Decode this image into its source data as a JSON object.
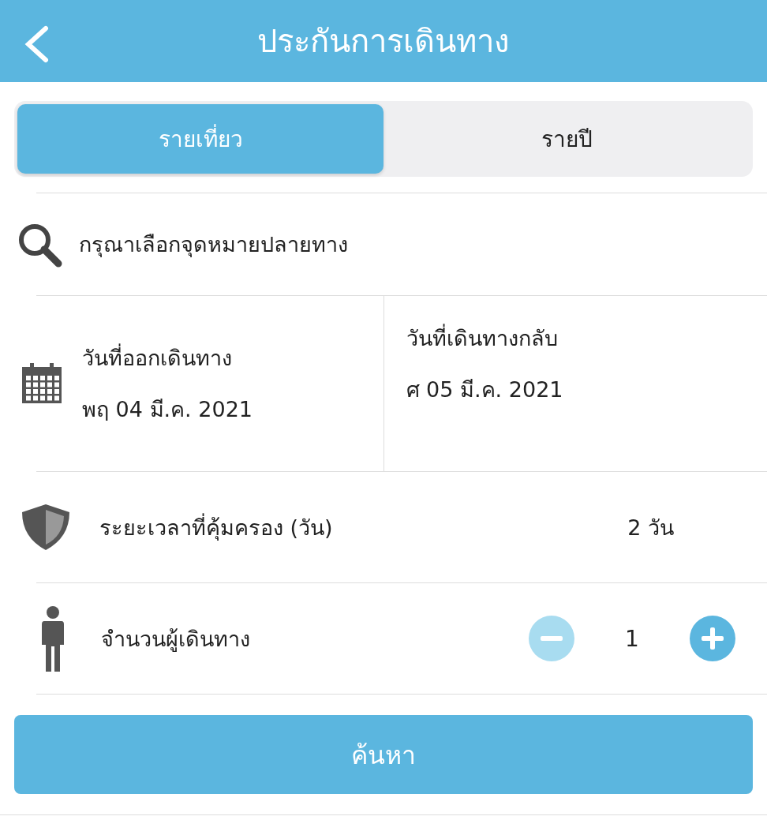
{
  "header": {
    "title": "ประกันการเดินทาง"
  },
  "tabs": [
    {
      "label": "รายเที่ยว",
      "selected": true
    },
    {
      "label": "รายปี",
      "selected": false
    }
  ],
  "destination": {
    "placeholder": "กรุณาเลือกจุดหมายปลายทาง"
  },
  "dates": [
    {
      "label": "วันที่ออกเดินทาง",
      "value": "พฤ 04 มี.ค. 2021"
    },
    {
      "label": "วันที่เดินทางกลับ",
      "value": "ศ 05 มี.ค. 2021"
    }
  ],
  "coverage": {
    "label": "ระยะเวลาที่คุ้มครอง (วัน)",
    "value": "2 วัน"
  },
  "travelers": {
    "label": "จำนวนผู้เดินทาง",
    "count": "1",
    "minus_disabled": true,
    "plus_disabled": false
  },
  "search_button": "ค้นหา"
}
